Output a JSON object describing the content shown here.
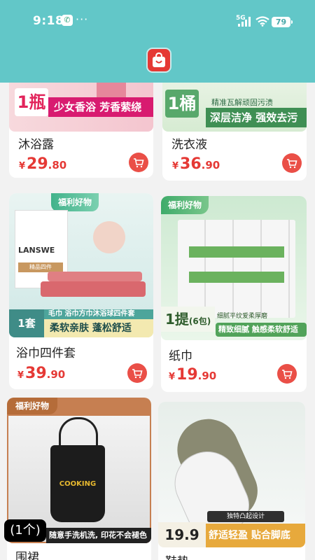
{
  "status": {
    "time": "9:18",
    "app_icon": "wechat-icon",
    "network": "5G",
    "battery": "79"
  },
  "products": [
    {
      "name": "沐浴露",
      "price_int": "29",
      "price_dec": ".80",
      "qty_label": "1瓶",
      "banner": "少女香浴 芳香萦绕"
    },
    {
      "name": "洗衣液",
      "price_int": "36",
      "price_dec": ".90",
      "qty_label": "1桶",
      "tagline": "精准瓦解顽固污渍",
      "banner": "深层洁净 强效去污"
    },
    {
      "name": "浴巾四件套",
      "price_int": "39",
      "price_dec": ".90",
      "badge": "福利好物",
      "brand": "LANSWE",
      "brand_sub": "精品四件",
      "qty_label": "1套",
      "strip": "毛巾 浴巾方巾沐浴球四件套",
      "banner": "柔软亲肤 蓬松舒适"
    },
    {
      "name": "纸巾",
      "price_int": "19",
      "price_dec": ".90",
      "badge": "福利好物",
      "qty_label": "1提",
      "qty_sub": "(6包)",
      "strip": "细腻平纹爱柔厚磨",
      "banner": "精致细腻 触感柔软舒适"
    },
    {
      "name": "围裙",
      "badge": "福利好物",
      "apron_text": "COOKING",
      "banner": "随意手洗机洗, 印花不会褪色"
    },
    {
      "name": "鞋垫",
      "price_text": "19.9",
      "tag": "独特凸起设计",
      "banner": "舒适轻盈 贴合脚底"
    }
  ],
  "overlay_count": "(1个)",
  "currency": "¥"
}
